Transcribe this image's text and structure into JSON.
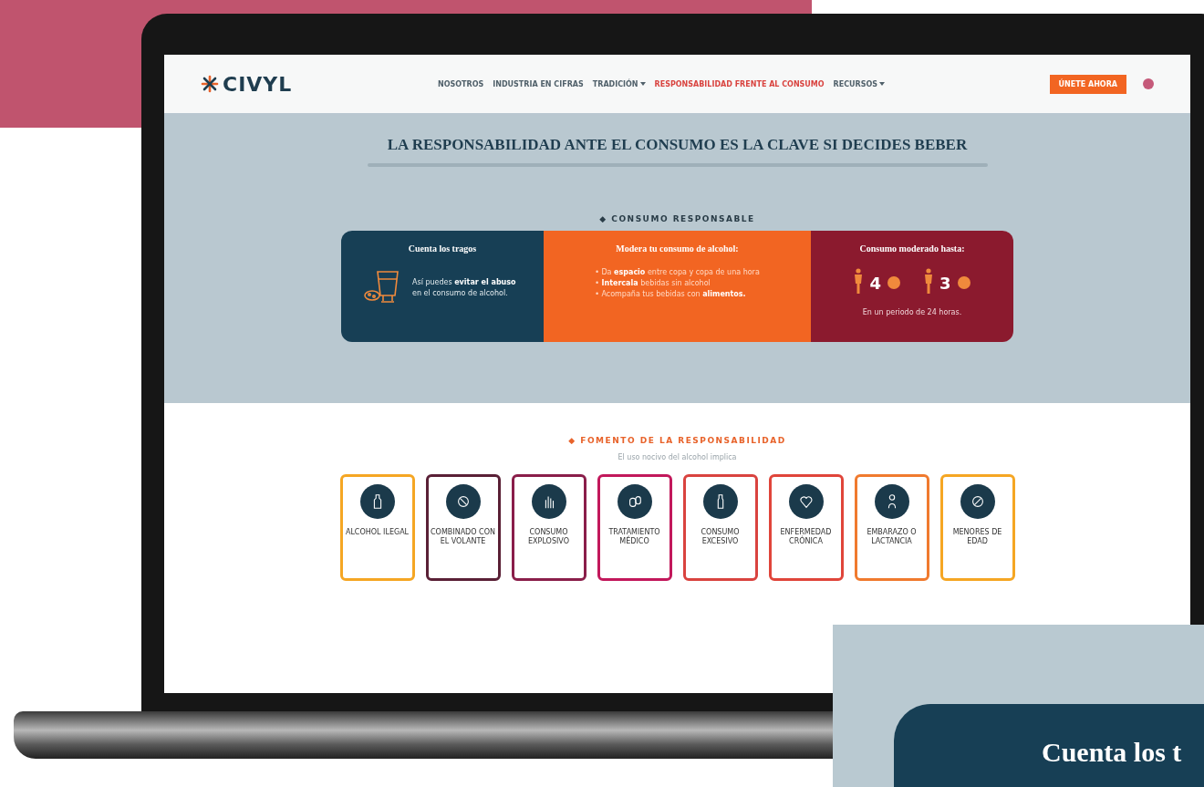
{
  "header": {
    "logo": "CIVYL",
    "nav": [
      {
        "label": "NOSOTROS",
        "selected": false,
        "dropdown": false
      },
      {
        "label": "INDUSTRIA EN CIFRAS",
        "selected": false,
        "dropdown": false
      },
      {
        "label": "TRADICIÓN",
        "selected": false,
        "dropdown": true
      },
      {
        "label": "RESPONSABILIDAD FRENTE AL CONSUMO",
        "selected": true,
        "dropdown": false
      },
      {
        "label": "RECURSOS",
        "selected": false,
        "dropdown": true
      }
    ],
    "button": "ÚNETE AHORA"
  },
  "hero": {
    "title": "LA RESPONSABILIDAD ANTE EL CONSUMO ES LA CLAVE SI DECIDES BEBER",
    "section_label": "◆ CONSUMO RESPONSABLE",
    "cards": [
      {
        "kind": "count",
        "title": "Cuenta los tragos",
        "text": "Así puedes **evitar el abuso** en el consumo de alcohol."
      },
      {
        "kind": "tips",
        "title": "Modera tu consumo de alcohol:",
        "items": [
          "• Da **espacio** entre copa y copa de una hora",
          "• **Intercala** bebidas sin alcohol",
          "• Acompaña tus bebidas con **alimentos.**"
        ]
      },
      {
        "kind": "limits",
        "title": "Consumo moderado hasta:",
        "limits": [
          {
            "value": "4"
          },
          {
            "value": "3"
          }
        ],
        "note": "En un periodo de 24 horas."
      }
    ]
  },
  "risks": {
    "section_label": "◆ FOMENTO DE LA RESPONSABILIDAD",
    "subtitle": "El uso nocivo del alcohol implica",
    "items": [
      {
        "label": "ALCOHOL ILEGAL",
        "color": "#f5a623"
      },
      {
        "label": "COMBINADO CON EL VOLANTE",
        "color": "#5a2036"
      },
      {
        "label": "CONSUMO EXPLOSIVO",
        "color": "#8a1e4a"
      },
      {
        "label": "TRATAMIENTO MÉDICO",
        "color": "#c2185b"
      },
      {
        "label": "CONSUMO EXCESIVO",
        "color": "#d9433f"
      },
      {
        "label": "ENFERMEDAD CRÓNICA",
        "color": "#e0453a"
      },
      {
        "label": "EMBARAZO O LACTANCIA",
        "color": "#f07a2e"
      },
      {
        "label": "MENORES DE EDAD",
        "color": "#f5a623"
      }
    ]
  },
  "inset": {
    "title": "Cuenta los t"
  }
}
